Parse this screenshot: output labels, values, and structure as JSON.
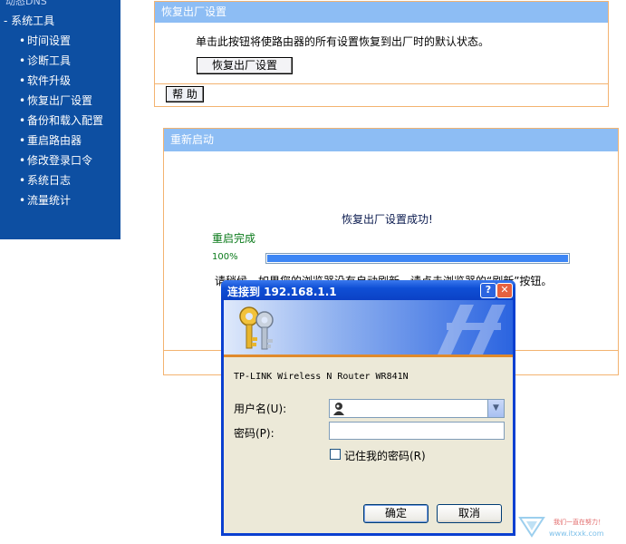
{
  "sidebar": {
    "top_item": "动态DNS",
    "group_label": "系统工具",
    "group_marker": "-",
    "bullet": "•",
    "items": [
      {
        "label": "时间设置"
      },
      {
        "label": "诊断工具"
      },
      {
        "label": "软件升级"
      },
      {
        "label": "恢复出厂设置"
      },
      {
        "label": "备份和载入配置"
      },
      {
        "label": "重启路由器"
      },
      {
        "label": "修改登录口令"
      },
      {
        "label": "系统日志"
      },
      {
        "label": "流量统计"
      }
    ]
  },
  "factory_panel": {
    "title": "恢复出厂设置",
    "description": "单击此按钮将使路由器的所有设置恢复到出厂时的默认状态。",
    "restore_button": "恢复出厂设置",
    "help_button": "帮 助"
  },
  "reboot_panel": {
    "title": "重新启动",
    "success_message": "恢复出厂设置成功!",
    "reboot_status": "重启完成",
    "progress_label": "100%",
    "progress_fraction": 1.0,
    "note": "请稍候，如果您的浏览器没有自动刷新，请点击浏览器的“刷新”按钮。"
  },
  "login_dialog": {
    "title": "连接到 192.168.1.1",
    "help_glyph": "?",
    "close_glyph": "✕",
    "device_text": "TP-LINK Wireless N Router WR841N",
    "username_label": "用户名(U):",
    "username_value": "",
    "password_label": "密码(P):",
    "password_value": "",
    "remember_label": "记住我的密码(R)",
    "remember_checked": false,
    "ok_button": "确定",
    "cancel_button": "取消",
    "dropdown_glyph": "▼"
  },
  "watermark": {
    "slogan": "我们一直在努力！",
    "url": "www.itxxk.com"
  },
  "colors": {
    "sidebar_bg": "#0d4fa2",
    "panel_header": "#8dbdf4",
    "panel_border": "#f3b370",
    "progress_fill": "#3d86f5",
    "dialog_title": "#0b41c6"
  }
}
